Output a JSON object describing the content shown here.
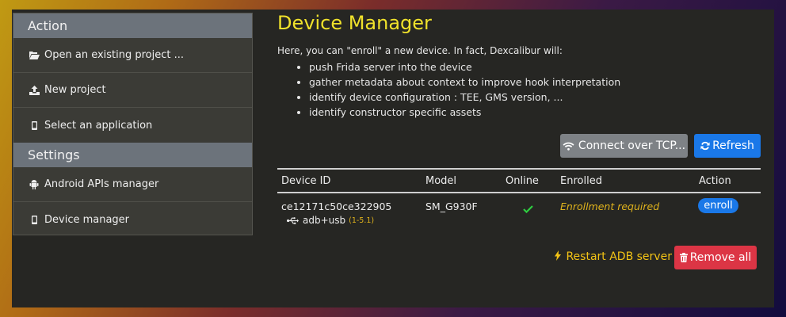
{
  "sidebar": {
    "sections": [
      {
        "header": "Action",
        "items": [
          {
            "label": "Open an existing project ...",
            "icon": "folder-open-icon"
          },
          {
            "label": "New project",
            "icon": "upload-icon"
          },
          {
            "label": "Select an application",
            "icon": "mobile-icon"
          }
        ]
      },
      {
        "header": "Settings",
        "items": [
          {
            "label": "Android APIs manager",
            "icon": "android-icon"
          },
          {
            "label": "Device manager",
            "icon": "mobile-icon"
          }
        ]
      }
    ]
  },
  "main": {
    "title": "Device Manager",
    "intro": "Here, you can \"enroll\" a new device. In fact, Dexcalibur will:",
    "points": [
      "push Frida server into the device",
      "gather metadata about context to improve hook interpretation",
      "identify device configuration : TEE, GMS version, ...",
      "identify constructor specific assets"
    ],
    "buttons": {
      "connect_tcp": "Connect over TCP...",
      "refresh": "Refresh",
      "restart_adb": "Restart ADB server",
      "remove_all": "Remove all"
    },
    "table": {
      "headers": [
        "Device ID",
        "Model",
        "Online",
        "Enrolled",
        "Action"
      ],
      "rows": [
        {
          "device_id": "ce12171c50ce322905",
          "connection": "adb+usb",
          "connection_version": "(1-5.1)",
          "model": "SM_G930F",
          "online": true,
          "enrolled": "Enrollment required",
          "action": "enroll"
        }
      ]
    }
  },
  "colors": {
    "accent_title": "#f0e22b",
    "primary": "#1a78e8",
    "danger": "#dc3545",
    "warning": "#f3c315",
    "success": "#2ecc40",
    "panel_bg": "#262623",
    "sidebar_header": "#6c737b"
  }
}
